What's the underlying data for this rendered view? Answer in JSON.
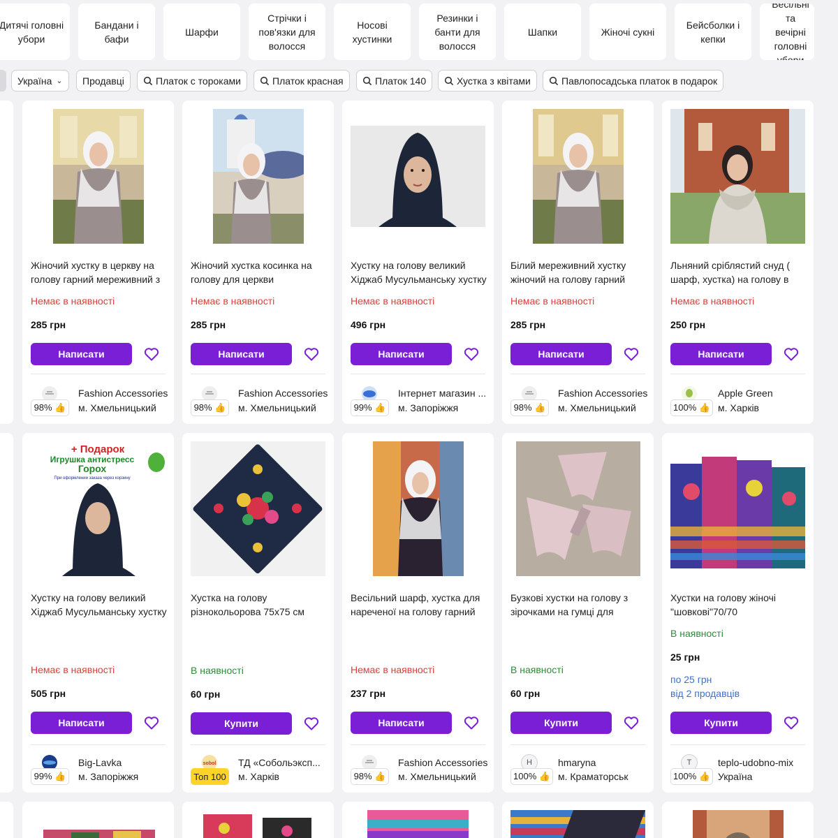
{
  "categories": [
    "Дитячі головні\nубори",
    "Бандани і\nбафи",
    "Шарфи",
    "Стрічки і\nпов'язки для\nволосся",
    "Носові\nхустинки",
    "Резинки і\nбанти для\nволосся",
    "Шапки",
    "Жіночі сукні",
    "Бейсболки і\nкепки",
    "Весільні та\nвечірні\nголовні убори"
  ],
  "filters": [
    {
      "label": "Україна",
      "icon": "",
      "dropdown": true
    },
    {
      "label": "Продавці",
      "icon": "",
      "dropdown": false
    },
    {
      "label": "Платок с тороками",
      "icon": "search-icon"
    },
    {
      "label": "Платок красная",
      "icon": "search-icon"
    },
    {
      "label": "Платок 140",
      "icon": "search-icon"
    },
    {
      "label": "Хустка з квітами",
      "icon": "search-icon"
    },
    {
      "label": "Павлопосадська платок в подарок",
      "icon": "search-icon"
    }
  ],
  "products": [
    {
      "title": "Жіночий хустку в церкву на голову гарний мереживний з",
      "status": "Немає в наявності",
      "in_stock": false,
      "price": "285 грн",
      "button": "Написати",
      "seller": "Fashion Accessories",
      "rating": "98% 👍",
      "city": "м. Хмельницький"
    },
    {
      "title": "Жіночий хустка косинка на голову для церкви",
      "status": "Немає в наявності",
      "in_stock": false,
      "price": "285 грн",
      "button": "Написати",
      "seller": "Fashion Accessories",
      "rating": "98% 👍",
      "city": "м. Хмельницький"
    },
    {
      "title": "Хустку на голову великий Хіджаб Мусульманську хустку",
      "status": "Немає в наявності",
      "in_stock": false,
      "price": "496 грн",
      "button": "Написати",
      "seller": "Інтернет магазин ...",
      "rating": "99% 👍",
      "city": "м. Запоріжжя"
    },
    {
      "title": "Білий мереживний хустку жіночий на голову гарний",
      "status": "Немає в наявності",
      "in_stock": false,
      "price": "285 грн",
      "button": "Написати",
      "seller": "Fashion Accessories",
      "rating": "98% 👍",
      "city": "м. Хмельницький"
    },
    {
      "title": "Льняний сріблястий снуд ( шарф, хустка) на голову в",
      "status": "Немає в наявності",
      "in_stock": false,
      "price": "250 грн",
      "button": "Написати",
      "seller": "Apple Green",
      "rating": "100% 👍",
      "city": "м. Харків"
    },
    {
      "title": "Хустку на голову великий Хіджаб Мусульманську хустку",
      "status": "Немає в наявності",
      "in_stock": false,
      "price": "505 грн",
      "button": "Написати",
      "seller": "Big-Lavka",
      "rating": "99% 👍",
      "city": "м. Запоріжжя",
      "promo": {
        "line1": "+ Подарок",
        "line2": "Игрушка антистресс",
        "line3": "Горох",
        "line4": "При оформлении заказа через корзину"
      }
    },
    {
      "title": "Хустка на голову різнокольорова 75х75 см",
      "status": "В наявності",
      "in_stock": true,
      "price": "60 грн",
      "button": "Купити",
      "seller": "ТД «Собольэксп...",
      "rating": "Топ 100",
      "city": "м. Харків"
    },
    {
      "title": "Весільний шарф, хустка для нареченої на голову гарний",
      "status": "Немає в наявності",
      "in_stock": false,
      "price": "237 грн",
      "button": "Написати",
      "seller": "Fashion Accessories",
      "rating": "98% 👍",
      "city": "м. Хмельницький"
    },
    {
      "title": "Бузкові хустки на голову з зірочками на гумці для",
      "status": "В наявності",
      "in_stock": true,
      "price": "60 грн",
      "button": "Купити",
      "seller": "hmaryna",
      "rating": "100% 👍",
      "city": "м. Краматорськ"
    },
    {
      "title": "Хустки на голову жіночі \"шовкові\"70/70",
      "status": "В наявності",
      "in_stock": true,
      "price": "25 грн",
      "button": "Купити",
      "seller": "teplo-udobno-mix",
      "rating": "100% 👍",
      "city": "Україна",
      "extra1": "по 25 грн",
      "extra2": "від 2 продавців"
    }
  ],
  "logos": {
    "hmaryna": "H",
    "teplo": "T",
    "sobol": "sobol"
  },
  "colors": {
    "accent": "#7a1fd6",
    "out_of_stock": "#e03b3b",
    "in_stock": "#2e8b3a",
    "link": "#3a6fd8",
    "top_badge": "#ffd429"
  }
}
